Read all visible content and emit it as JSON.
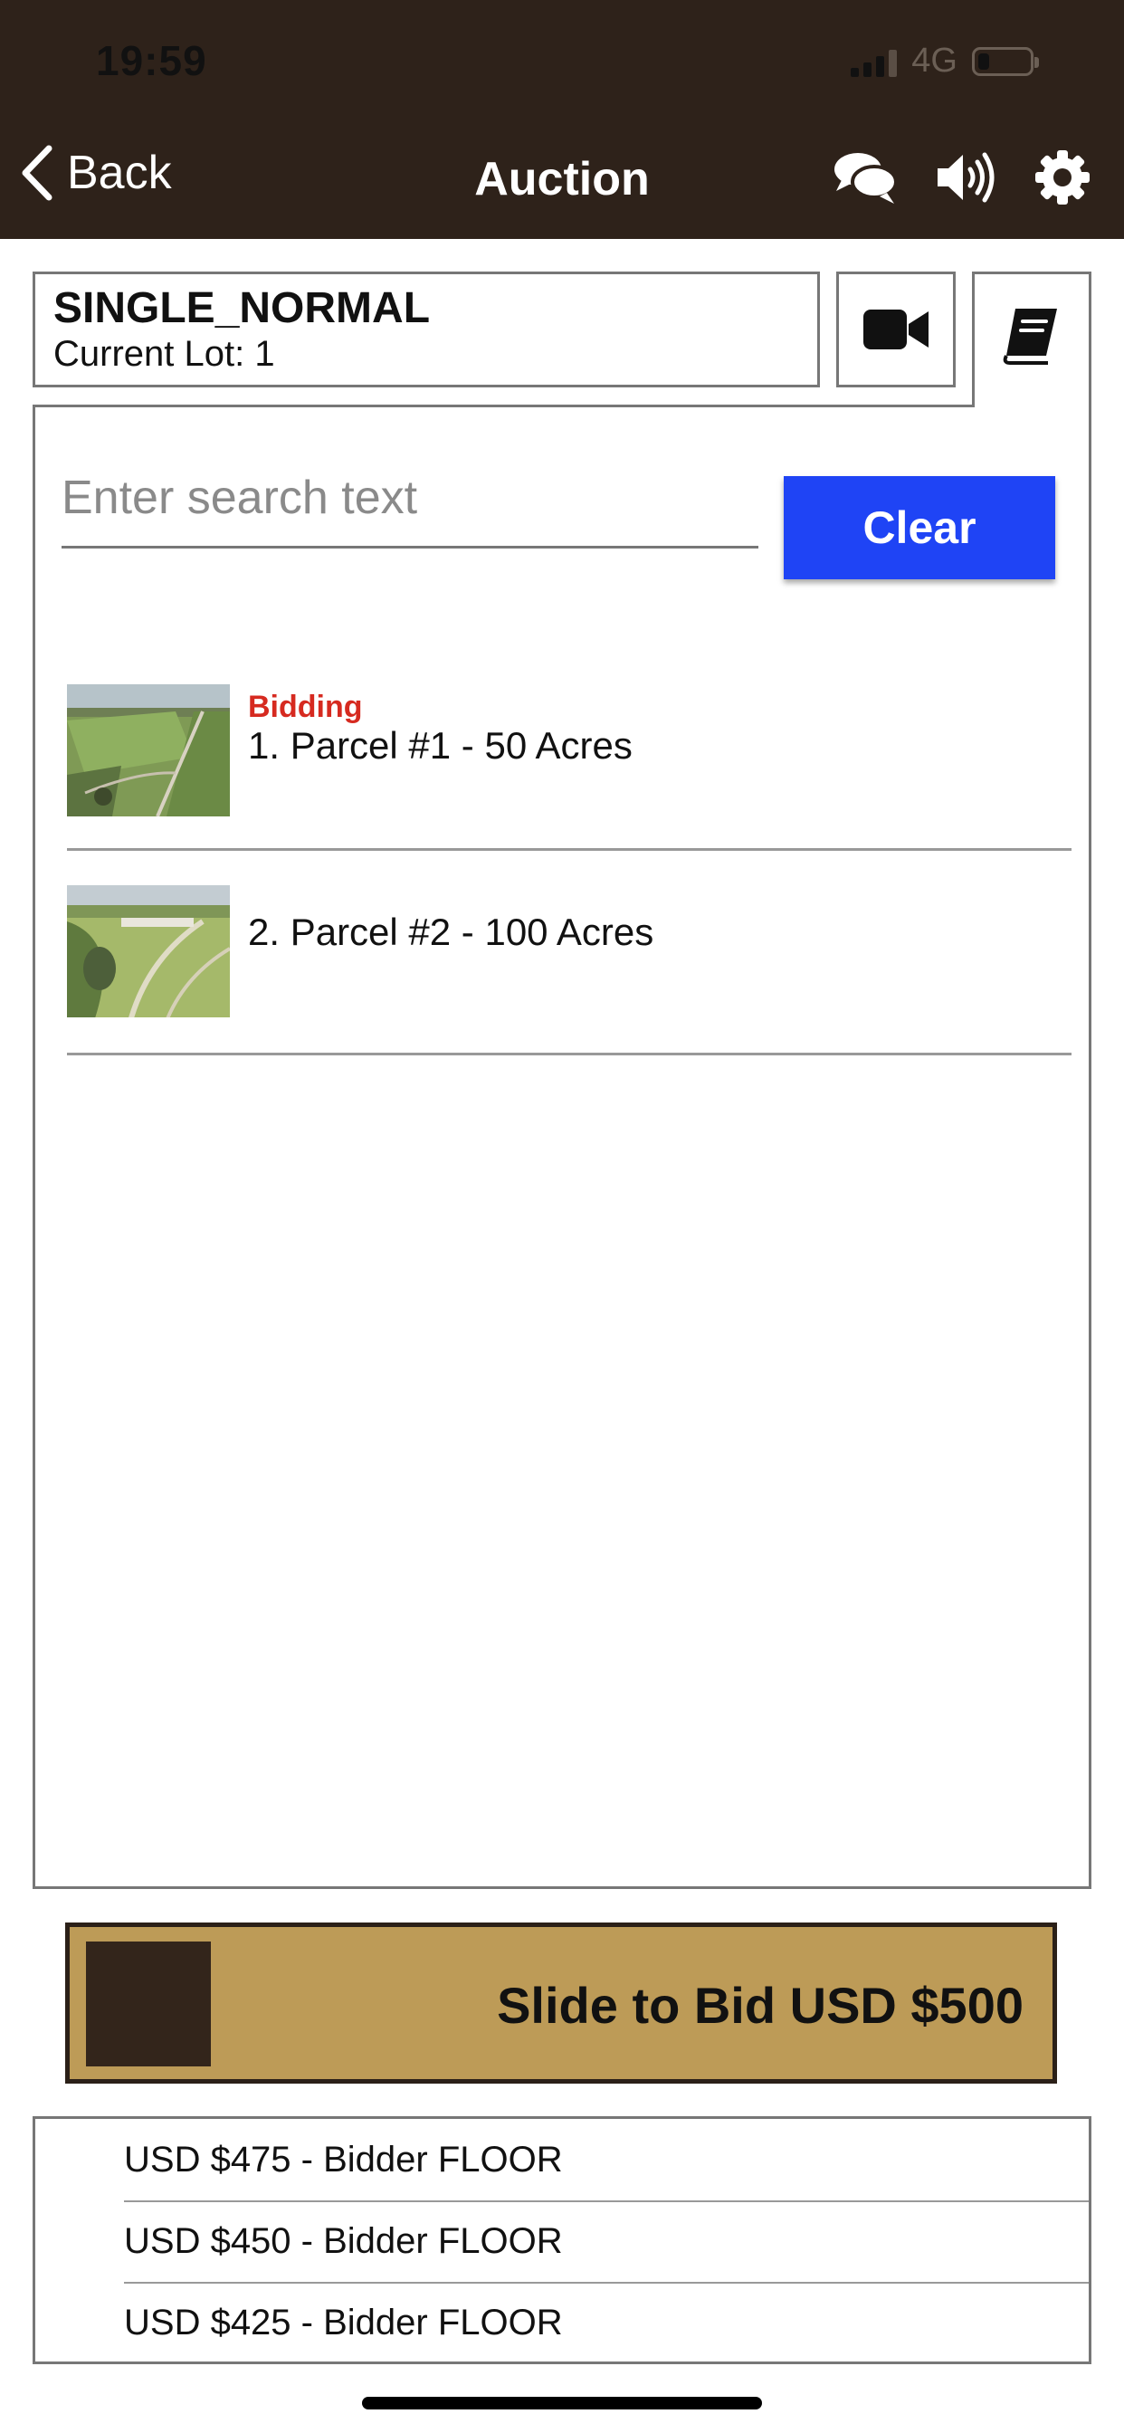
{
  "status_bar": {
    "time": "19:59",
    "network": "4G"
  },
  "nav": {
    "back_label": "Back",
    "title": "Auction",
    "icons": [
      "chat-icon",
      "volume-icon",
      "gear-icon",
      "chevron-left-icon"
    ]
  },
  "auction": {
    "name": "SINGLE_NORMAL",
    "current_lot": "Current Lot: 1"
  },
  "tabs": {
    "video_icon": "video-camera-icon",
    "catalog_icon": "book-icon"
  },
  "search": {
    "placeholder": "Enter search text",
    "clear_label": "Clear"
  },
  "lots": [
    {
      "status": "Bidding",
      "title": "1. Parcel #1 - 50 Acres"
    },
    {
      "status": "",
      "title": "2. Parcel #2 - 100 Acres"
    }
  ],
  "bid_slider": {
    "label": "Slide to Bid USD $500"
  },
  "bid_history": [
    "USD $475 - Bidder FLOOR",
    "USD $450 - Bidder FLOOR",
    "USD $425 - Bidder FLOOR"
  ],
  "colors": {
    "header_bg": "#2e221a",
    "clear_button": "#1f44f5",
    "bidding_status": "#d62a20",
    "slider_bg": "#bd9b57",
    "slider_knob": "#33251b"
  }
}
